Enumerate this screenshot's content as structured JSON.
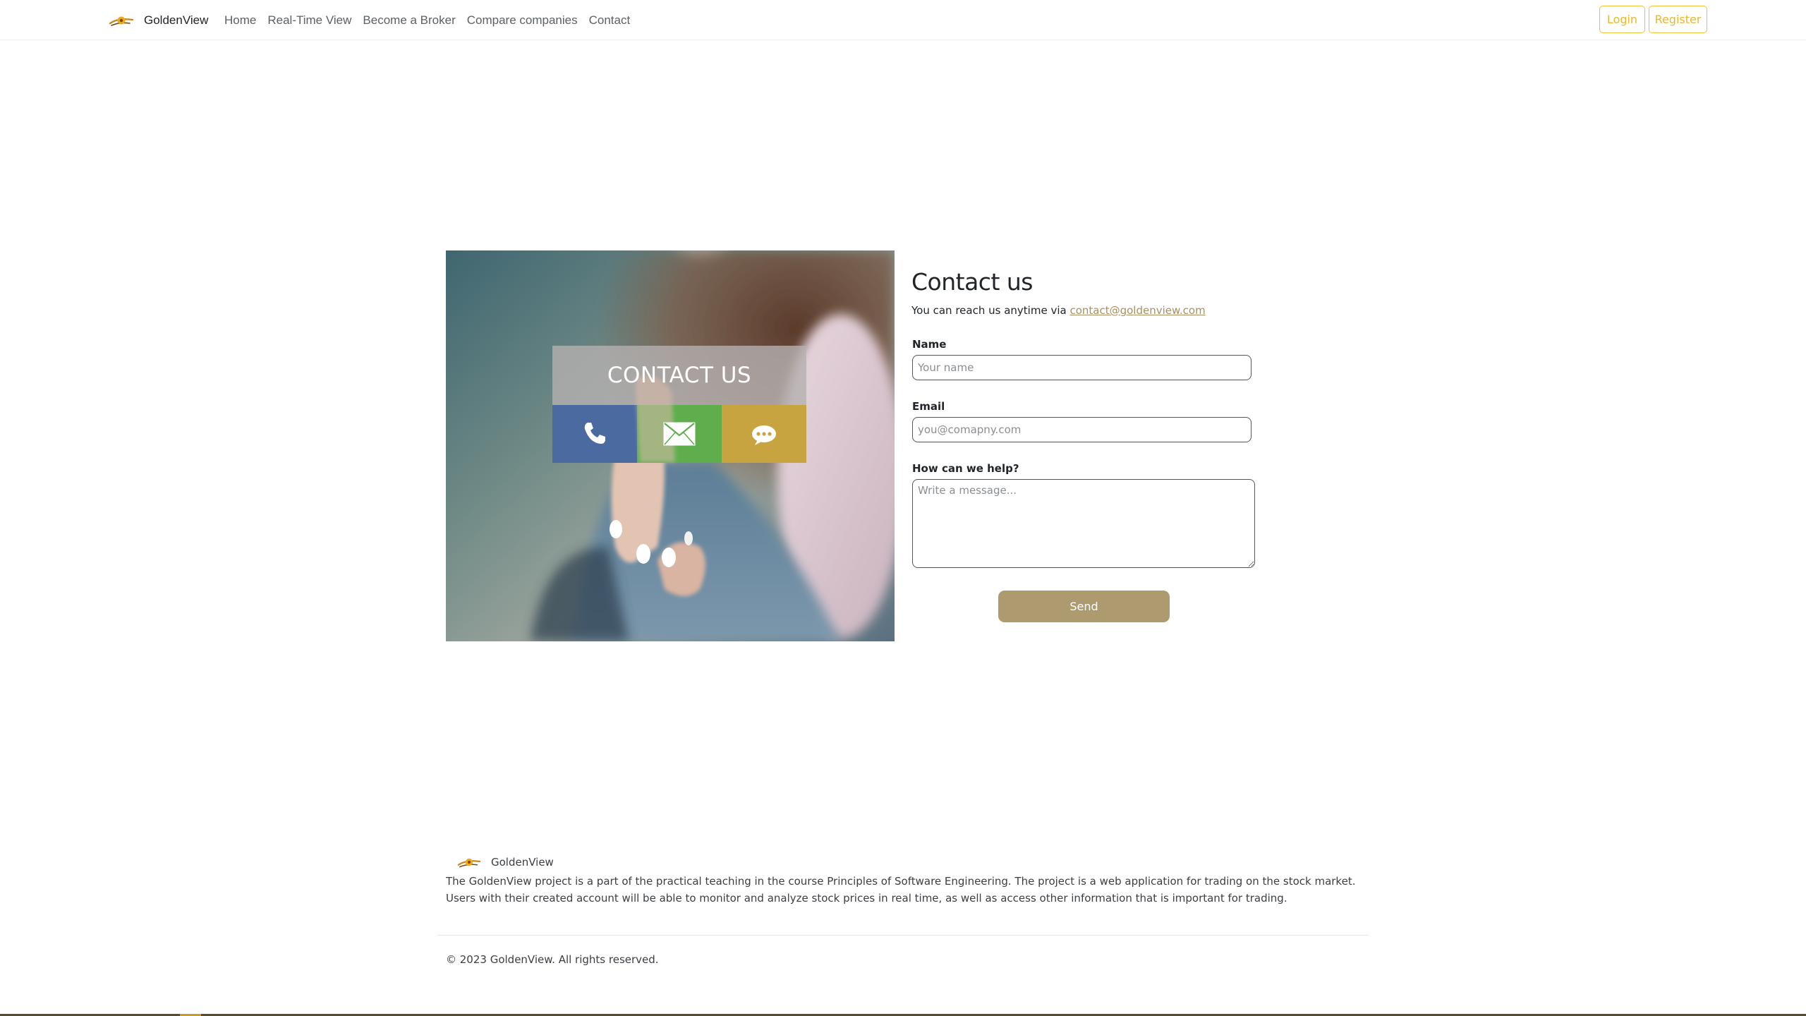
{
  "brand": {
    "name": "GoldenView"
  },
  "nav": {
    "links": [
      {
        "label": "Home"
      },
      {
        "label": "Real-Time View"
      },
      {
        "label": "Become a Broker"
      },
      {
        "label": "Compare companies"
      },
      {
        "label": "Contact"
      }
    ],
    "login_label": "Login",
    "register_label": "Register"
  },
  "hero": {
    "overlay_text": "CONTACT US",
    "tiles": [
      {
        "icon": "phone-icon",
        "color": "#4a6aa0"
      },
      {
        "icon": "envelope-icon",
        "color": "#5fae4e"
      },
      {
        "icon": "chat-bubble-icon",
        "color": "#c8a440"
      }
    ]
  },
  "contact": {
    "title": "Contact us",
    "subtitle_prefix": "You can reach us anytime via",
    "email_link": "contact@goldenview.com",
    "name_label": "Name",
    "name_placeholder": "Your name",
    "email_label": "Email",
    "email_placeholder": "you@comapny.com",
    "message_label": "How can we help?",
    "message_placeholder": "Write a message...",
    "send_label": "Send"
  },
  "footer": {
    "brand": "GoldenView",
    "description": "The GoldenView project is a part of the practical teaching in the course Principles of Software Engineering. The project is a web application for trading on the stock market. Users with their created account will be able to monitor and analyze stock prices in real time, as well as access other information that is important for trading.",
    "copyright": "© 2023 GoldenView. All rights reserved."
  },
  "colors": {
    "accent_gold": "#e9b72a",
    "send_button": "#ad9a6e",
    "link": "#a88f5f"
  }
}
